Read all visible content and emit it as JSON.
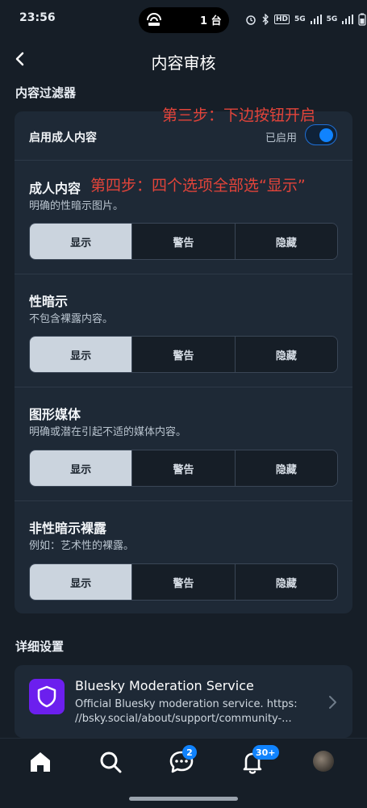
{
  "status_bar": {
    "time": "23:56",
    "island_text": "1 台",
    "icons": [
      "alarm-icon",
      "bluetooth-icon",
      "hd-icon",
      "5g-signal-icon",
      "5g-signal-icon",
      "battery-icon"
    ],
    "hd_text": "HD",
    "sig1_text": "5G",
    "sig2_text": "5G"
  },
  "header": {
    "title": "内容审核"
  },
  "filters": {
    "section_title": "内容过滤器",
    "adult": {
      "label": "启用成人内容",
      "state_text": "已启用",
      "enabled": true
    },
    "annotations": {
      "step3": "第三步：下边按钮开启",
      "step4": "第四步：四个选项全部选“显示”"
    },
    "categories": [
      {
        "title": "成人内容",
        "desc": "明确的性暗示图片。",
        "options": [
          "显示",
          "警告",
          "隐藏"
        ],
        "selected": "显示"
      },
      {
        "title": "性暗示",
        "desc": "不包含裸露内容。",
        "options": [
          "显示",
          "警告",
          "隐藏"
        ],
        "selected": "显示"
      },
      {
        "title": "图形媒体",
        "desc": "明确或潜在引起不适的媒体内容。",
        "options": [
          "显示",
          "警告",
          "隐藏"
        ],
        "selected": "显示"
      },
      {
        "title": "非性暗示裸露",
        "desc": "例如：艺术性的裸露。",
        "options": [
          "显示",
          "警告",
          "隐藏"
        ],
        "selected": "显示"
      }
    ]
  },
  "advanced": {
    "section_title": "详细设置",
    "service": {
      "name": "Bluesky Moderation Service",
      "desc_line1": "Official Bluesky moderation service. https:",
      "desc_line2": "//bsky.social/about/support/community-..."
    }
  },
  "tabbar": {
    "tabs": [
      "home-tab",
      "search-tab",
      "messages-tab",
      "notifications-tab",
      "profile-tab"
    ],
    "messages_badge": "2",
    "notifications_badge": "30+"
  },
  "colors": {
    "accent": "#1083fe",
    "background": "#161e27",
    "card": "#1e2936",
    "annotation": "#e3443a",
    "service_logo": "#6c1fee"
  }
}
